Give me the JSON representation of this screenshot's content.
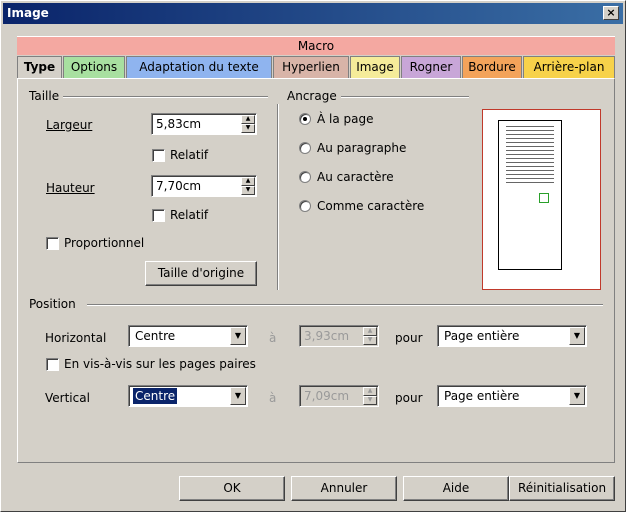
{
  "window": {
    "title": "Image",
    "close_glyph": "×"
  },
  "macro_tab": {
    "label": "Macro",
    "color": "#f4a8a1"
  },
  "tabs": [
    {
      "label": "Type",
      "color": "#d4d0c8",
      "active": true
    },
    {
      "label": "Options",
      "color": "#a8e0a0"
    },
    {
      "label": "Adaptation du texte",
      "color": "#8fb4ef"
    },
    {
      "label": "Hyperlien",
      "color": "#d8b4a8"
    },
    {
      "label": "Image",
      "color": "#f5ec9a"
    },
    {
      "label": "Rogner",
      "color": "#c8a6d8"
    },
    {
      "label": "Bordure",
      "color": "#f3a35a"
    },
    {
      "label": "Arrière-plan",
      "color": "#f7d24a"
    }
  ],
  "size": {
    "group_label": "Taille",
    "width_label": "Largeur",
    "width_value": "5,83cm",
    "width_relative_label": "Relatif",
    "height_label": "Hauteur",
    "height_value": "7,70cm",
    "height_relative_label": "Relatif",
    "proportional_label": "Proportionnel",
    "original_size_button": "Taille d'origine"
  },
  "anchor": {
    "group_label": "Ancrage",
    "options": [
      "À la page",
      "Au paragraphe",
      "Au caractère",
      "Comme caractère"
    ],
    "selected": "À la page"
  },
  "position": {
    "group_label": "Position",
    "horizontal_label": "Horizontal",
    "horizontal_value": "Centre",
    "h_by_label": "à",
    "h_by_value": "3,93cm",
    "h_to_label": "pour",
    "h_to_value": "Page entière",
    "mirror_label": "En vis-à-vis sur les pages paires",
    "vertical_label": "Vertical",
    "vertical_value": "Centre",
    "v_by_label": "à",
    "v_by_value": "7,09cm",
    "v_to_label": "pour",
    "v_to_value": "Page entière"
  },
  "buttons": {
    "ok": "OK",
    "cancel": "Annuler",
    "help": "Aide",
    "reset": "Réinitialisation"
  },
  "icons": {
    "spin_up": "▲",
    "spin_down": "▼",
    "dropdown": "▼"
  }
}
